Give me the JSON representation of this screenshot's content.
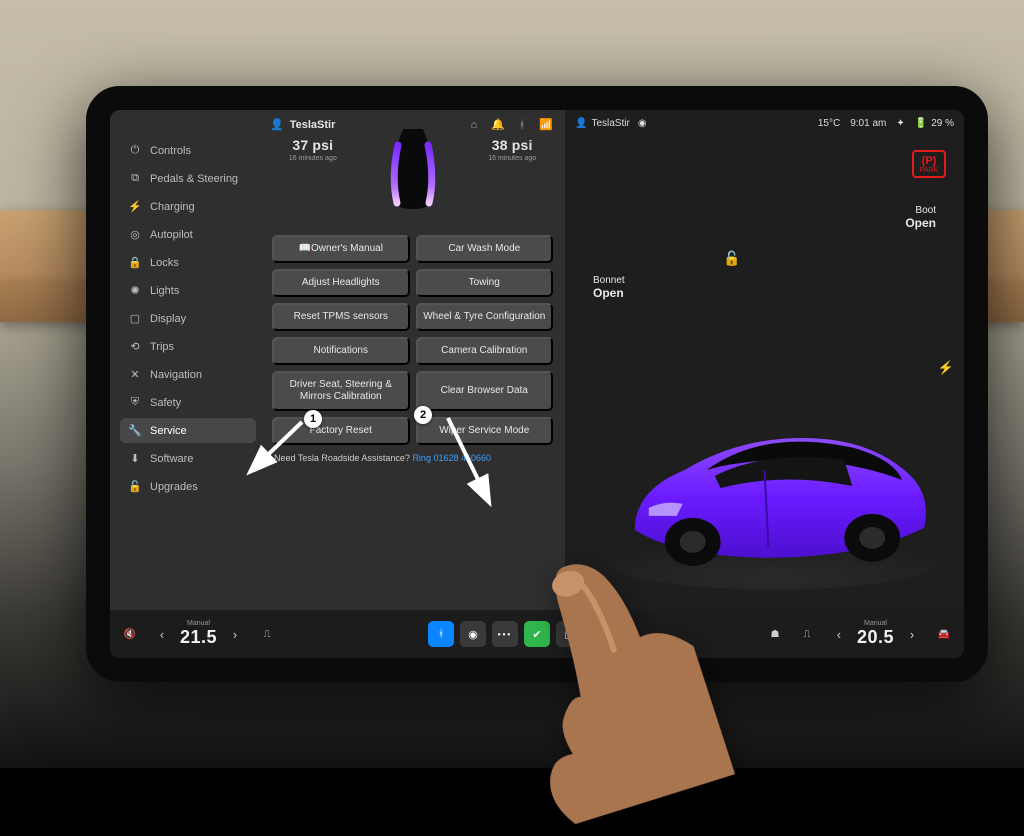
{
  "status": {
    "profile_icon": "user",
    "profile_name": "TeslaStir",
    "temperature": "15°C",
    "time": "9:01 am",
    "battery_pct": "29 %"
  },
  "sidebar": {
    "items": [
      {
        "icon": "⌀",
        "label": "Controls"
      },
      {
        "icon": "🚗",
        "label": "Pedals & Steering"
      },
      {
        "icon": "⚡",
        "label": "Charging"
      },
      {
        "icon": "◎",
        "label": "Autopilot"
      },
      {
        "icon": "🔒",
        "label": "Locks"
      },
      {
        "icon": "✦",
        "label": "Lights"
      },
      {
        "icon": "▢",
        "label": "Display"
      },
      {
        "icon": "⟲",
        "label": "Trips"
      },
      {
        "icon": "✕",
        "label": "Navigation"
      },
      {
        "icon": "⛨",
        "label": "Safety"
      },
      {
        "icon": "🔧",
        "label": "Service",
        "selected": true
      },
      {
        "icon": "⬇",
        "label": "Software"
      },
      {
        "icon": "🔓",
        "label": "Upgrades"
      }
    ]
  },
  "center_header": {
    "profile": "TeslaStir",
    "icons": [
      "home",
      "bell",
      "bluetooth",
      "wifi"
    ]
  },
  "tpms": {
    "left": {
      "value": "37 psi",
      "sub": "16 minutes ago"
    },
    "right": {
      "value": "38 psi",
      "sub": "16 minutes ago"
    }
  },
  "tiles": [
    "Owner's Manual",
    "Car Wash Mode",
    "Adjust Headlights",
    "Towing",
    "Reset TPMS sensors",
    "Wheel & Tyre Configuration",
    "Notifications",
    "Camera Calibration",
    "Driver Seat, Steering & Mirrors Calibration",
    "Clear Browser Data",
    "Factory Reset",
    "Wiper Service Mode"
  ],
  "assist": {
    "text": "Need Tesla Roadside Assistance?",
    "link": "Ring 01628 450660"
  },
  "car_status": {
    "park": "PARK",
    "bonnet_label": "Bonnet",
    "bonnet_state": "Open",
    "boot_label": "Boot",
    "boot_state": "Open"
  },
  "dock": {
    "left_temp_label": "Manual",
    "left_temp": "21.5",
    "right_temp_label": "Manual",
    "right_temp": "20.5"
  },
  "annotations": {
    "1": "1",
    "2": "2"
  }
}
